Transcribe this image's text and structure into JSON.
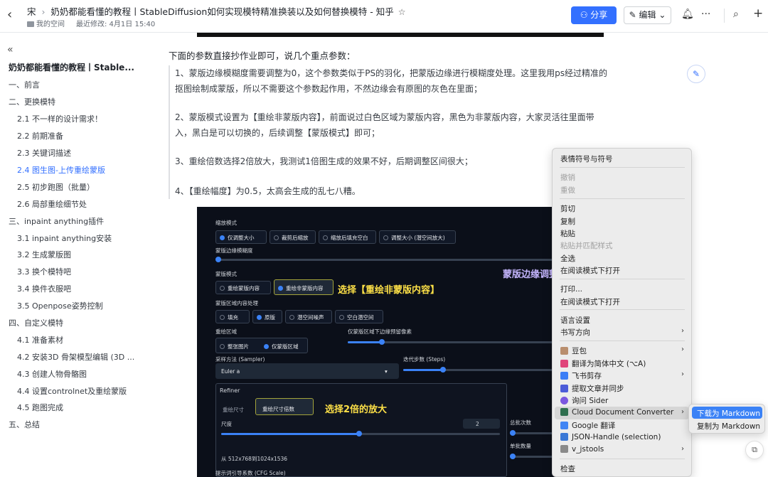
{
  "topbar": {
    "crumb_prefix": "宋",
    "title": "奶奶都能看懂的教程丨StableDiffusion如何实现模特精准换装以及如何替换模特 - 知乎",
    "space": "我的空间",
    "modified": "最近修改: 4月1日 15:40",
    "share_label": "分享",
    "edit_label": "编辑"
  },
  "sidebar": {
    "doc_title": "奶奶都能看懂的教程丨Stable...",
    "toc": [
      {
        "label": "一、前言"
      },
      {
        "label": "二、更换模特"
      },
      {
        "label": "2.1 不一样的设计需求！"
      },
      {
        "label": "2.2 前期准备"
      },
      {
        "label": "2.3 关键词描述"
      },
      {
        "label": "2.4 图生图-上传重绘蒙版"
      },
      {
        "label": "2.5 初步跑图（批量）"
      },
      {
        "label": "2.6 局部重绘细节处"
      },
      {
        "label": "三、inpaint anything插件"
      },
      {
        "label": "3.1 inpaint anything安装"
      },
      {
        "label": "3.2 生成蒙版图"
      },
      {
        "label": "3.3 换个模特吧"
      },
      {
        "label": "3.4 换件衣服吧"
      },
      {
        "label": "3.5 Openpose姿势控制"
      },
      {
        "label": "四、自定义模特"
      },
      {
        "label": "4.1 准备素材"
      },
      {
        "label": "4.2 安装3D 骨架模型编辑 (3D ..."
      },
      {
        "label": "4.3 创建人物骨骼图"
      },
      {
        "label": "4.4 设置controlnet及重绘蒙版"
      },
      {
        "label": "4.5 跑图完成"
      },
      {
        "label": "五、总结"
      }
    ]
  },
  "content": {
    "intro": "下面的参数直接抄作业即可，说几个重点参数：",
    "p1a": "1、蒙版边缘模糊度需要调整为0，这个参数类似于PS的羽化，把蒙版边缘进行模糊度处理。这里我用ps经过精准的",
    "p1b": "抠图绘制成蒙版，所以不需要这个参数起作用，不然边缘会有原图的灰色在里面；",
    "p2a": "2、蒙版模式设置为【重绘非蒙版内容】，前面说过白色区域为蒙版内容，黑色为非蒙版内容，大家灵活往里面带",
    "p2b": "入，黑白是可以切换的，后续调整【蒙版模式】即可；",
    "p3": "3、重绘倍数选择2倍放大，我测试1倍图生成的效果不好，后期调整区间很大；",
    "p4": "4、【重绘幅度】为0.5，太高会生成的乱七八糟。"
  },
  "shot": {
    "resize_mode": "缩放模式",
    "rm_opts": [
      "仅调整大小",
      "裁剪后缩放",
      "缩放后填充空白",
      "调整大小 (潜空间放大)"
    ],
    "mask_blur": "蒙版边缘模糊度",
    "mask_mode": "蒙版模式",
    "mm_opts": [
      "重绘蒙版内容",
      "重绘非蒙版内容"
    ],
    "anno1": "选择【重绘非蒙版内容】",
    "anno_top": "蒙版边缘调整",
    "fill_mode": "蒙版区域内容处理",
    "fill_opts": [
      "填充",
      "原版",
      "潜空间噪声",
      "空白潜空间"
    ],
    "inpaint_area": "重绘区域",
    "ia_opts": [
      "整张图片",
      "仅蒙版区域"
    ],
    "padding": "仅蒙版区域下边缘预留像素",
    "sampler_label": "采样方法 (Sampler)",
    "sampler": "Euler a",
    "steps": "迭代步数 (Steps)",
    "refiner": "Refiner",
    "tab_a": "重绘尺寸",
    "tab_b": "重绘尺寸倍数",
    "anno2": "选择2倍的放大",
    "scale_label": "尺度",
    "scale_val": "2",
    "batch_count": "总批次数",
    "batch_size": "单批数量",
    "from_to": "从 512x768到1024x1536",
    "cfg": "提示词引导系数 (CFG Scale)"
  },
  "context_menu": {
    "emoji": "表情符号与符号",
    "undo": "撤销",
    "redo": "重做",
    "cut": "剪切",
    "copy": "复制",
    "paste": "粘贴",
    "paste_match": "粘贴并匹配样式",
    "select_all": "全选",
    "open_reader": "在阅读模式下打开",
    "print": "打印...",
    "open_reader2": "在阅读模式下打开",
    "language": "语言设置",
    "writing_dir": "书写方向",
    "doubao": "豆包",
    "translate_zh": "翻译为简体中文 (⌥A)",
    "feishu": "飞书剪存",
    "extract": "提取文章并同步",
    "sider": "询问 Sider",
    "cloud_doc": "Cloud Document Converter",
    "google_tr": "Google 翻译",
    "json_handle": "JSON-Handle (selection)",
    "jstools": "v_jstools",
    "inspect": "检查"
  },
  "submenu": {
    "download_md": "下载为 Markdown",
    "copy_md": "复制为 Markdown"
  },
  "colors": {
    "accent": "#3370ff",
    "menu_highlight": "#3b82f6"
  }
}
